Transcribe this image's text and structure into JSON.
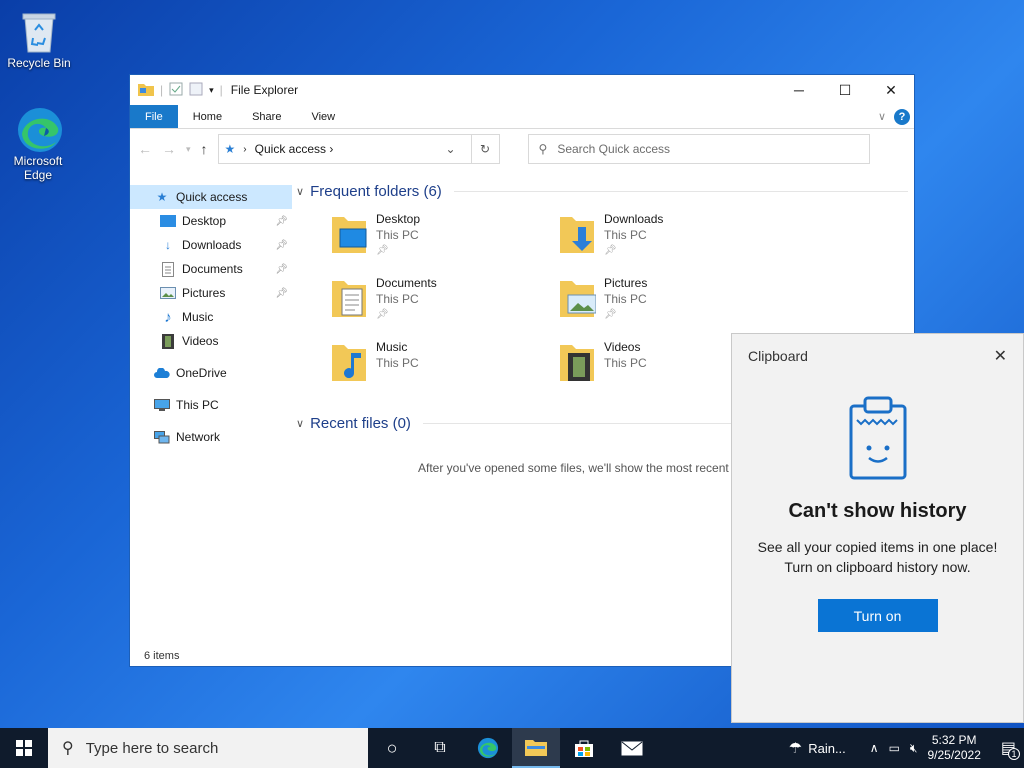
{
  "desktop": {
    "icons": [
      {
        "label": "Recycle Bin"
      },
      {
        "label": "Microsoft Edge"
      }
    ]
  },
  "explorer": {
    "title": "File Explorer",
    "ribbon_tabs": [
      "File",
      "Home",
      "Share",
      "View"
    ],
    "address_path": "Quick access",
    "search_placeholder": "Search Quick access",
    "sidebar": {
      "quick_access": "Quick access",
      "pinned": [
        "Desktop",
        "Downloads",
        "Documents",
        "Pictures"
      ],
      "unpinned": [
        "Music",
        "Videos"
      ],
      "onedrive": "OneDrive",
      "this_pc": "This PC",
      "network": "Network"
    },
    "frequent_header": "Frequent folders (6)",
    "folders": [
      {
        "name": "Desktop",
        "location": "This PC"
      },
      {
        "name": "Downloads",
        "location": "This PC"
      },
      {
        "name": "Documents",
        "location": "This PC"
      },
      {
        "name": "Pictures",
        "location": "This PC"
      },
      {
        "name": "Music",
        "location": "This PC"
      },
      {
        "name": "Videos",
        "location": "This PC"
      }
    ],
    "recent_header": "Recent files (0)",
    "recent_empty": "After you've opened some files, we'll show the most recent",
    "status": "6 items"
  },
  "clipboard": {
    "title": "Clipboard",
    "heading": "Can't show history",
    "line1": "See all your copied items in one place!",
    "line2": "Turn on clipboard history now.",
    "button": "Turn on"
  },
  "taskbar": {
    "search_placeholder": "Type here to search",
    "weather": "Rain...",
    "time": "5:32 PM",
    "date": "9/25/2022",
    "notification_count": "1"
  },
  "colors": {
    "accent": "#1979ca",
    "button": "#0a74d4",
    "selection": "#cce8ff"
  }
}
